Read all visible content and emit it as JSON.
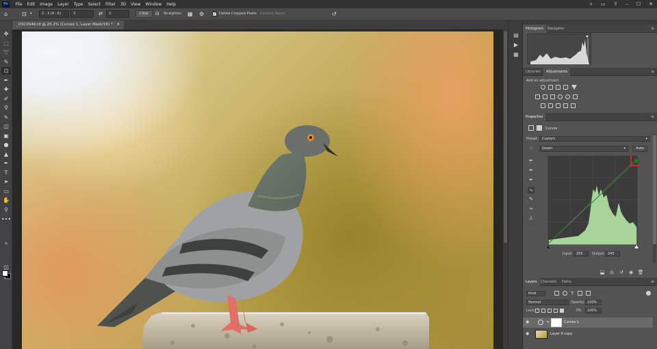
{
  "app": {
    "logo": "Ps"
  },
  "menu": [
    "File",
    "Edit",
    "Image",
    "Layer",
    "Type",
    "Select",
    "Filter",
    "3D",
    "View",
    "Window",
    "Help"
  ],
  "window_controls": [
    "search-icon",
    "workspace-icon",
    "share-icon",
    "minimize",
    "maximize",
    "close"
  ],
  "options_bar": {
    "ratio": "2 : 3 (4 : 6)",
    "width": "3",
    "height": "2",
    "clear_label": "Clear",
    "straighten_label": "Straighten",
    "delete_cropped_label": "Delete Cropped Pixels",
    "delete_cropped_checked": true,
    "content_aware_label": "Content-Aware"
  },
  "document": {
    "tab_title": "_DSC0546.tif @ 25.2% (Curves 1, Layer Mask/16) *"
  },
  "panels": {
    "histogram_tab": "Histogram",
    "navigator_tab": "Navigator",
    "libraries_tab": "Libraries",
    "adjustments_tab": "Adjustments",
    "add_adjustment_label": "Add an adjustment",
    "properties_tab": "Properties",
    "properties_title": "Curves",
    "preset_label": "Preset:",
    "preset_value": "Custom",
    "channel_value": "Green",
    "auto_label": "Auto",
    "input_label": "Input:",
    "input_value": "255",
    "output_label": "Output:",
    "output_value": "245"
  },
  "layers": {
    "tabs": [
      "Layers",
      "Channels",
      "Paths"
    ],
    "filter_value": "Kind",
    "blend_mode": "Normal",
    "opacity_label": "Opacity:",
    "opacity_value": "100%",
    "lock_label": "Lock:",
    "fill_label": "Fill:",
    "fill_value": "100%",
    "items": [
      {
        "name": "Curves 1",
        "selected": true,
        "visible": true
      },
      {
        "name": "Layer 0 copy",
        "selected": false,
        "visible": true
      }
    ]
  },
  "colors": {
    "highlight_point": "#e02020",
    "curve_line": "#2f7a2f",
    "histogram_fill": "#a6d49a"
  }
}
